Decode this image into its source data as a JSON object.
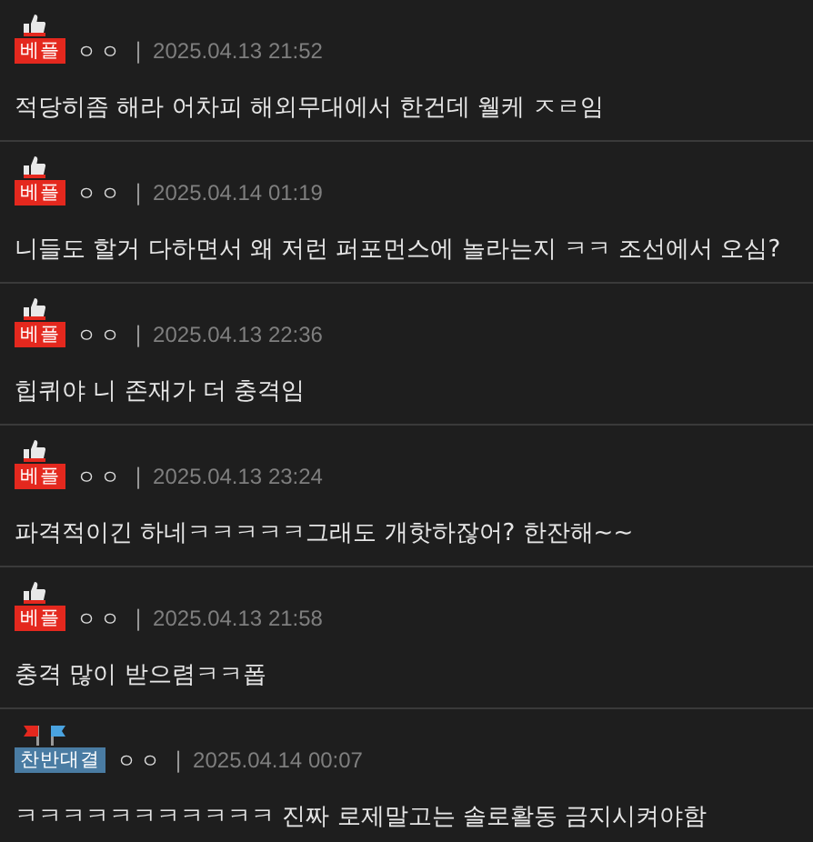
{
  "comments": [
    {
      "badge": {
        "kind": "best",
        "label": "베플"
      },
      "nickname": "ㅇㅇ",
      "separator": "|",
      "date": "2025.04.13 21:52",
      "text": "적당히좀 해라 어차피 해외무대에서 한건데 웰케 ㅈㄹ임"
    },
    {
      "badge": {
        "kind": "best",
        "label": "베플"
      },
      "nickname": "ㅇㅇ",
      "separator": "|",
      "date": "2025.04.14 01:19",
      "text": "니들도 할거 다하면서 왜 저런 퍼포먼스에 놀라는지 ㅋㅋ 조선에서 오심?"
    },
    {
      "badge": {
        "kind": "best",
        "label": "베플"
      },
      "nickname": "ㅇㅇ",
      "separator": "|",
      "date": "2025.04.13 22:36",
      "text": "힙퀴야 니 존재가 더 충격임"
    },
    {
      "badge": {
        "kind": "best",
        "label": "베플"
      },
      "nickname": "ㅇㅇ",
      "separator": "|",
      "date": "2025.04.13 23:24",
      "text": "파격적이긴 하네ㅋㅋㅋㅋㅋ그래도 개핫하잖어? 한잔해~~"
    },
    {
      "badge": {
        "kind": "best",
        "label": "베플"
      },
      "nickname": "ㅇㅇ",
      "separator": "|",
      "date": "2025.04.13 21:58",
      "text": "충격 많이 받으렴ㅋㅋ폽"
    },
    {
      "badge": {
        "kind": "debate",
        "label": "찬반대결"
      },
      "nickname": "ㅇㅇ",
      "separator": "|",
      "date": "2025.04.14 00:07",
      "text": "ㅋㅋㅋㅋㅋㅋㅋㅋㅋㅋㅋ 진짜 로제말고는 솔로활동 금지시켜야함"
    }
  ]
}
